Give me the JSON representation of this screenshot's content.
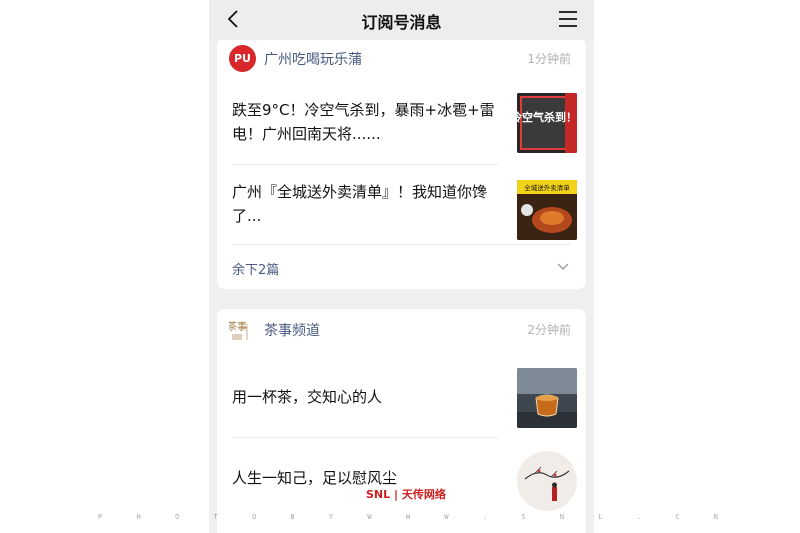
{
  "nav": {
    "title": "订阅号消息"
  },
  "cards": [
    {
      "source": "广州吃喝玩乐蒲",
      "avatar_text": "PU",
      "time": "1分钟前",
      "articles": [
        {
          "title": "跌至9°C！冷空气杀到，暴雨+冰雹+雷电！广州回南天将......",
          "thumb_text": "冷空气杀到！"
        },
        {
          "title": "广州『全城送外卖清单』！我知道你馋了...",
          "thumb_text": "全城送外卖清单"
        }
      ],
      "more_label": "余下2篇"
    },
    {
      "source": "茶事频道",
      "avatar_text": "茶事",
      "time": "2分钟前",
      "articles": [
        {
          "title": "用一杯茶，交知心的人"
        },
        {
          "title": "人生一知己，足以慰风尘"
        }
      ]
    }
  ],
  "watermark": {
    "logo": "SNL | 天传网络",
    "strip": [
      "P",
      "H",
      "O",
      "T",
      "O",
      "B",
      "Y",
      "W",
      "W",
      "W",
      ".",
      "S",
      "N",
      "L",
      ".",
      "C",
      "N"
    ]
  },
  "colors": {
    "brand_red": "#d8262a",
    "link_blue": "#4a5a82",
    "time_gray": "#b2b2b2",
    "bg": "#efeff1"
  }
}
